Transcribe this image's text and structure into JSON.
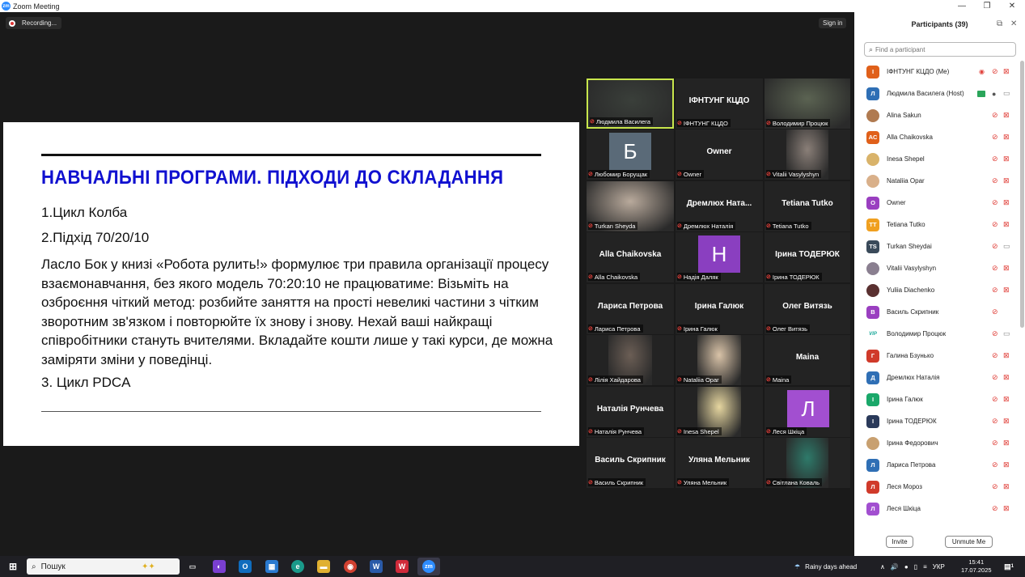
{
  "window": {
    "title": "Zoom Meeting",
    "logo": "zm",
    "minimize": "—",
    "restore": "❐",
    "close": "✕"
  },
  "meeting": {
    "recording_label": "Recording...",
    "signin_label": "Sign in"
  },
  "slide": {
    "heading": "НАВЧАЛЬНІ ПРОГРАМИ. ПІДХОДИ ДО СКЛАДАННЯ",
    "line1": "1.Цикл Колба",
    "line2": "2.Підхід 70/20/10",
    "paragraph": "Ласло Бок у  книзі «Робота рулить!» формулює три правила організації процесу взаємонавчання, без якого модель 70:20:10 не працюватиме: Візьміть на озброєння чіткий метод: розбийте заняття на прості невеликі частини з чітким зворотним зв'язком і повторюйте їх знову і знову. Нехай ваші найкращі співробітники стануть вчителями. Вкладайте кошти лише у такі курси, де можна заміряти зміни у поведінці.",
    "line3": "3. Цикл PDCA"
  },
  "tiles": [
    {
      "label": "Людмила Василега",
      "big": "",
      "kind": "photo",
      "color": "#3a3f3a",
      "active": true
    },
    {
      "label": "ІФНТУНГ КЦДО",
      "big": "ІФНТУНГ КЦДО",
      "kind": "name"
    },
    {
      "label": "Володимир Процюк",
      "big": "",
      "kind": "photo",
      "color": "#5b6352"
    },
    {
      "label": "Любомир Борущак",
      "big": "Б",
      "kind": "avatar",
      "color": "#5a6a78"
    },
    {
      "label": "Owner",
      "big": "Owner",
      "kind": "name"
    },
    {
      "label": "Vitalii Vasylyshyn",
      "big": "",
      "kind": "photo",
      "color": "#8a7f78"
    },
    {
      "label": "Turkan Sheyda",
      "big": "",
      "kind": "photo",
      "color": "#b9aa9c"
    },
    {
      "label": "Дремлюх Наталія",
      "big": "Дремлюх  Ната...",
      "kind": "name"
    },
    {
      "label": "Tetiana Tutko",
      "big": "Tetiana Tutko",
      "kind": "name"
    },
    {
      "label": "Alla Chaikovska",
      "big": "Alla Chaikovska",
      "kind": "name"
    },
    {
      "label": "Надія Даляк",
      "big": "Н",
      "kind": "avatar",
      "color": "#8a3fc0"
    },
    {
      "label": "Ірина ТОДЕРЮК",
      "big": "Ірина ТОДЕРЮК",
      "kind": "name"
    },
    {
      "label": "Лариса Петрова",
      "big": "Лариса Петрова",
      "kind": "name"
    },
    {
      "label": "Ірина Галюк",
      "big": "Ірина Галюк",
      "kind": "name"
    },
    {
      "label": "Олег Витязь",
      "big": "Олег Витязь",
      "kind": "name"
    },
    {
      "label": "Лілія Хайдарова",
      "big": "",
      "kind": "photo",
      "color": "#6b5e55"
    },
    {
      "label": "Nataliia Opar",
      "big": "",
      "kind": "photo",
      "color": "#d9c3a8"
    },
    {
      "label": "Maina",
      "big": "Maina",
      "kind": "name"
    },
    {
      "label": "Наталія Рунчева",
      "big": "Наталія Рунчева",
      "kind": "name"
    },
    {
      "label": "Inesa Shepel",
      "big": "",
      "kind": "photo",
      "color": "#e6d6a0"
    },
    {
      "label": "Леся Шкіца",
      "big": "Л",
      "kind": "avatar",
      "color": "#a24fd0"
    },
    {
      "label": "Василь Скрипник",
      "big": "Василь Скрипник",
      "kind": "name"
    },
    {
      "label": "Уляна Мельник",
      "big": "Уляна Мельник",
      "kind": "name"
    },
    {
      "label": "Світлана Коваль",
      "big": "",
      "kind": "photo",
      "color": "#2e7a6a"
    }
  ],
  "participants_panel": {
    "title": "Participants (39)",
    "popout_icon": "⧉",
    "close_icon": "✕",
    "search_placeholder": "Find a participant",
    "invite_label": "Invite",
    "unmute_label": "Unmute Me",
    "list": [
      {
        "initials": "І",
        "name": "ІФНТУНГ КЦДО (Me)",
        "color": "#e0601a",
        "extra": "rec"
      },
      {
        "initials": "Л",
        "name": "Людмила Василега (Host)",
        "color": "#2f6fb5",
        "extra": "share",
        "mic_on": true,
        "cam_off": true
      },
      {
        "initials": "",
        "name": "Alina Sakun",
        "color": "#b07a50"
      },
      {
        "initials": "AC",
        "name": "Alla Chaikovska",
        "color": "#e0601a"
      },
      {
        "initials": "",
        "name": "Inesa Shepel",
        "color": "#d9b36a"
      },
      {
        "initials": "",
        "name": "Nataliia Opar",
        "color": "#d9b08a"
      },
      {
        "initials": "O",
        "name": "Owner",
        "color": "#9a3fc0"
      },
      {
        "initials": "TT",
        "name": "Tetiana Tutko",
        "color": "#f0a020"
      },
      {
        "initials": "TS",
        "name": "Turkan Sheydai",
        "color": "#3a4a5a",
        "cam_off": true
      },
      {
        "initials": "",
        "name": "Vitalii Vasylyshyn",
        "color": "#8a7f90"
      },
      {
        "initials": "",
        "name": "Yuliia Diachenko",
        "color": "#5a3030"
      },
      {
        "initials": "В",
        "name": "Василь Скрипник",
        "color": "#9a3fc0",
        "no_cam": true
      },
      {
        "initials": "VIP",
        "name": "Володимир Процюк",
        "color": "#1aa89a",
        "cam_off": true
      },
      {
        "initials": "Г",
        "name": "Галина Бзунько",
        "color": "#d03a2a"
      },
      {
        "initials": "Д",
        "name": "Дремлюх Наталія",
        "color": "#2f6fb5"
      },
      {
        "initials": "І",
        "name": "Ірина Галюк",
        "color": "#1aa86a"
      },
      {
        "initials": "І",
        "name": "Ірина ТОДЕРЮК",
        "color": "#2a3a5a"
      },
      {
        "initials": "",
        "name": "Ірина Федорович",
        "color": "#c8a070"
      },
      {
        "initials": "Л",
        "name": "Лариса Петрова",
        "color": "#2f6fb5"
      },
      {
        "initials": "Л",
        "name": "Леся Мороз",
        "color": "#d03a2a"
      },
      {
        "initials": "Л",
        "name": "Леся Шкіца",
        "color": "#a24fd0"
      }
    ]
  },
  "taskbar": {
    "search_label": "Пошук",
    "weather": "Rainy days ahead",
    "lang": "УКР",
    "time": "15:41",
    "date": "17.07.2025",
    "notification_count": "1"
  }
}
